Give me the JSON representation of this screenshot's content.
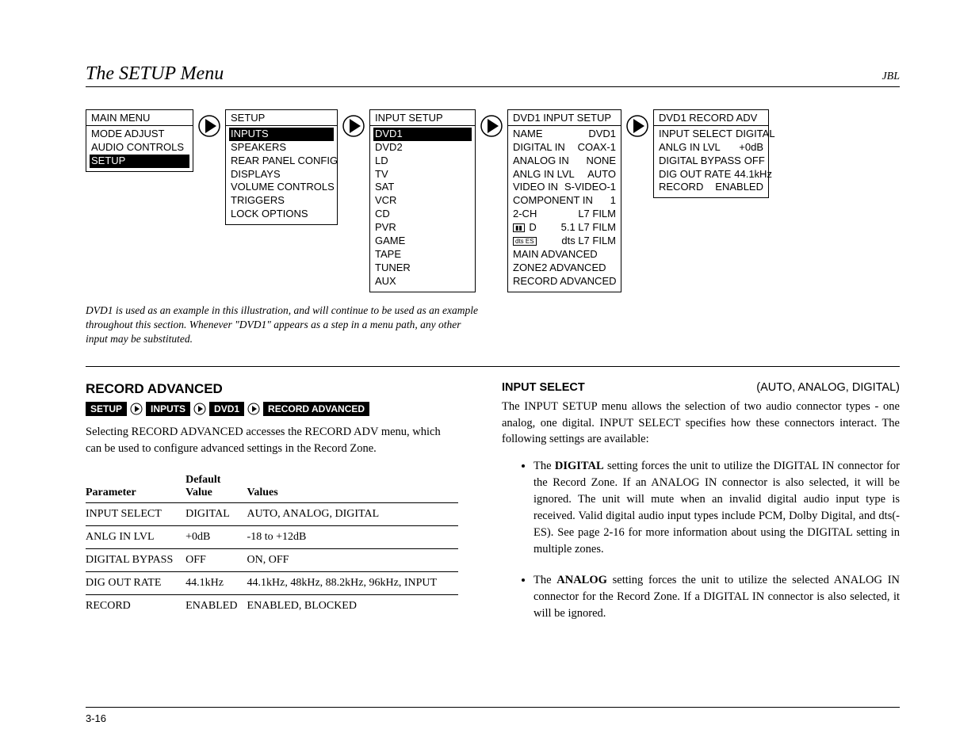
{
  "header": {
    "title": "The SETUP Menu",
    "brand": "JBL"
  },
  "menus": {
    "main": {
      "title": "MAIN MENU",
      "items": [
        "MODE ADJUST",
        "AUDIO CONTROLS",
        "SETUP"
      ],
      "selected": "SETUP",
      "sel_style": "inv"
    },
    "setup": {
      "title": "SETUP",
      "items": [
        "INPUTS",
        "SPEAKERS",
        "REAR PANEL CONFIG",
        "DISPLAYS",
        "VOLUME CONTROLS",
        "TRIGGERS",
        "LOCK OPTIONS"
      ],
      "selected": "INPUTS",
      "sel_style": "inv"
    },
    "input_setup": {
      "title": "INPUT SETUP",
      "items": [
        "DVD1",
        "DVD2",
        "LD",
        "TV",
        "SAT",
        "VCR",
        "CD",
        "PVR",
        "GAME",
        "TAPE",
        "TUNER",
        "AUX"
      ],
      "selected": "DVD1",
      "sel_style": "inv"
    },
    "dvd1_setup": {
      "title": "DVD1 INPUT SETUP",
      "kv": [
        {
          "k": "NAME",
          "v": "DVD1"
        },
        {
          "k": "DIGITAL IN",
          "v": "COAX-1"
        },
        {
          "k": "ANALOG IN",
          "v": "NONE"
        },
        {
          "k": "ANLG IN LVL",
          "v": "AUTO"
        },
        {
          "k": "VIDEO IN",
          "v": "S-VIDEO-1"
        },
        {
          "k": "COMPONENT IN",
          "v": "1"
        },
        {
          "k": "2-CH",
          "v": "L7 FILM"
        },
        {
          "k": "__DD__ D",
          "v": "5.1 L7 FILM"
        },
        {
          "k": "__DTS__",
          "v": "dts L7 FILM"
        }
      ],
      "extra": [
        "MAIN ADVANCED",
        "ZONE2 ADVANCED",
        "RECORD ADVANCED"
      ],
      "selected": "RECORD ADVANCED",
      "sel_style": "box"
    },
    "record_adv": {
      "title": "DVD1 RECORD ADV",
      "kv": [
        {
          "k": "INPUT SELECT",
          "v": "DIGITAL"
        },
        {
          "k": "ANLG IN LVL",
          "v": "+0dB"
        },
        {
          "k": "DIGITAL BYPASS",
          "v": "OFF"
        },
        {
          "k": "DIG OUT RATE",
          "v": "44.1kHz"
        },
        {
          "k": "RECORD",
          "v": "ENABLED"
        }
      ]
    }
  },
  "caption": "DVD1 is used as an example in this illustration, and will continue to be used as an example throughout this section. Whenever \"DVD1\" appears as a step in a menu path, any other input may be substituted.",
  "section": {
    "heading": "RECORD ADVANCED",
    "breadcrumb": [
      "SETUP",
      "INPUTS",
      "DVD1",
      "RECORD ADVANCED"
    ],
    "intro": "Selecting RECORD ADVANCED accesses the RECORD ADV menu, which can be used to configure advanced settings in the Record Zone."
  },
  "table": {
    "headers": [
      "Parameter",
      "Default Value",
      "Values"
    ],
    "rows": [
      [
        "INPUT SELECT",
        "DIGITAL",
        "AUTO, ANALOG, DIGITAL"
      ],
      [
        "ANLG IN LVL",
        "+0dB",
        "-18 to +12dB"
      ],
      [
        "DIGITAL BYPASS",
        "OFF",
        "ON, OFF"
      ],
      [
        "DIG OUT RATE",
        "44.1kHz",
        "44.1kHz, 48kHz, 88.2kHz, 96kHz, INPUT"
      ],
      [
        "RECORD",
        "ENABLED",
        "ENABLED, BLOCKED"
      ]
    ]
  },
  "right": {
    "heading": "INPUT SELECT",
    "options": "(AUTO, ANALOG, DIGITAL)",
    "intro": "The INPUT SETUP menu allows the selection of two audio connector types - one analog, one digital. INPUT SELECT specifies how these connectors interact. The following settings are available:",
    "bullets": [
      "The <b>DIGITAL</b> setting forces the unit to utilize the DIGITAL IN connector for the Record Zone. If an ANALOG IN connector is also selected, it will be ignored. The unit will mute when an invalid digital audio input type is received. Valid digital audio input types include PCM, Dolby Digital, and dts(-ES). See page 2-16 for more information about using the DIGITAL setting in multiple zones.",
      "The <b>ANALOG</b> setting forces  the unit to utilize the selected ANALOG IN connector for the Record Zone. If a DIGITAL IN connector is also selected, it will be ignored."
    ]
  },
  "footer": "3-16"
}
